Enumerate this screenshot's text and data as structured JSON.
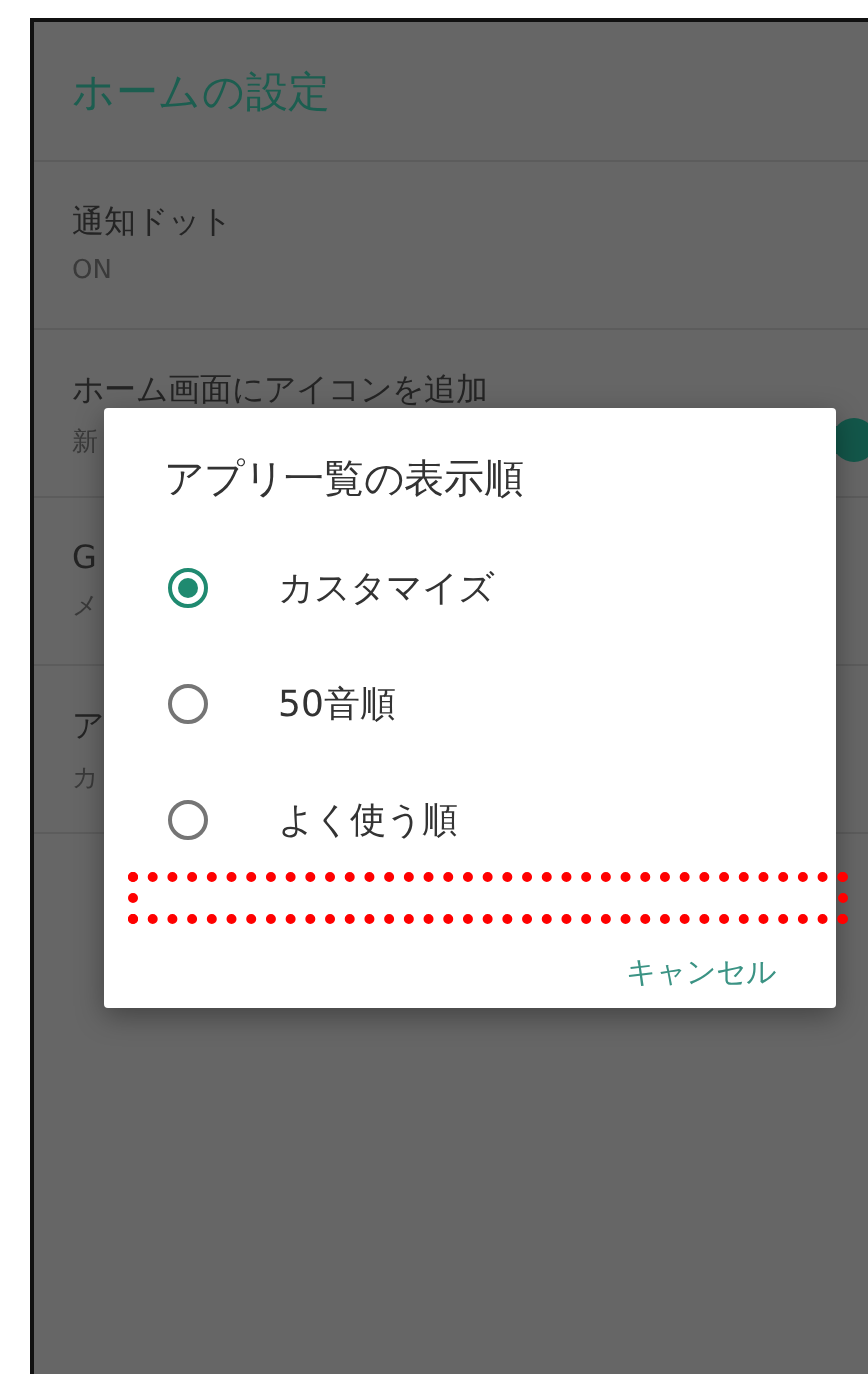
{
  "header": {
    "title": "ホームの設定"
  },
  "settings": [
    {
      "title": "通知ドット",
      "summary": "ON",
      "kind": "text"
    },
    {
      "title": "ホーム画面にアイコンを追加",
      "summary": "新",
      "kind": "switch",
      "on": true
    },
    {
      "title": "G",
      "summary": "メ",
      "kind": "text"
    },
    {
      "title": "ア",
      "summary": "カ",
      "kind": "text"
    }
  ],
  "dialog": {
    "title": "アプリ一覧の表示順",
    "options": [
      {
        "label": "カスタマイズ",
        "selected": true
      },
      {
        "label": "50音順",
        "selected": false
      },
      {
        "label": "よく使う順",
        "selected": false
      }
    ],
    "buttons": [
      "キャンセル"
    ]
  }
}
